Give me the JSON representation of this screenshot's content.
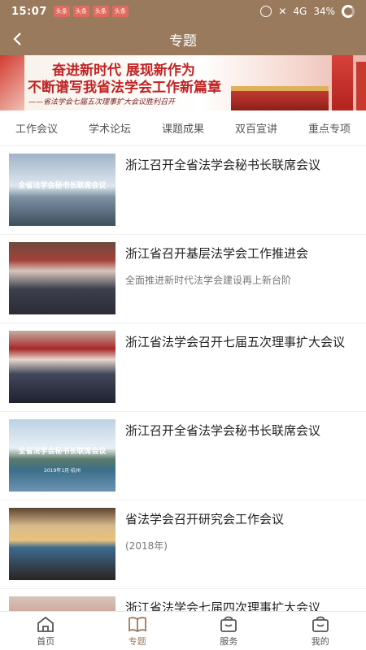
{
  "status": {
    "time": "15:07",
    "badge_text": "头条",
    "network": "4G",
    "battery": "34%"
  },
  "header": {
    "title": "专题"
  },
  "banner": {
    "line1": "奋进新时代  展现新作为",
    "line2": "不断谱写我省法学会工作新篇章",
    "line3": "——省法学会七届五次理事扩大会议胜利召开"
  },
  "tabs": [
    "工作会议",
    "学术论坛",
    "课题成果",
    "双百宣讲",
    "重点专项"
  ],
  "items": [
    {
      "title": "浙江召开全省法学会秘书长联席会议",
      "subtitle": "",
      "thumb_text": "全省法学会秘书长联席会议",
      "thumb_sub": ""
    },
    {
      "title": "浙江省召开基层法学会工作推进会",
      "subtitle": "全面推进新时代法学会建设再上新台阶",
      "thumb_text": "",
      "thumb_sub": ""
    },
    {
      "title": "浙江省法学会召开七届五次理事扩大会议",
      "subtitle": "",
      "thumb_text": "",
      "thumb_sub": ""
    },
    {
      "title": "浙江召开全省法学会秘书长联席会议",
      "subtitle": "",
      "thumb_text": "全省法学会秘书长联席会议",
      "thumb_sub": "2019年1月·杭州"
    },
    {
      "title": "省法学会召开研究会工作会议",
      "subtitle": "(2018年)",
      "thumb_text": "",
      "thumb_sub": ""
    },
    {
      "title": "浙江省法学会七届四次理事扩大会议",
      "subtitle": "",
      "thumb_text": "",
      "thumb_sub": ""
    }
  ],
  "nav": [
    {
      "label": "首页",
      "icon": "home-icon"
    },
    {
      "label": "专题",
      "icon": "book-icon"
    },
    {
      "label": "服务",
      "icon": "bag-icon"
    },
    {
      "label": "我的",
      "icon": "bag-icon"
    }
  ],
  "colors": {
    "brand": "#9a7a5d",
    "active": "#9a7a5d"
  }
}
